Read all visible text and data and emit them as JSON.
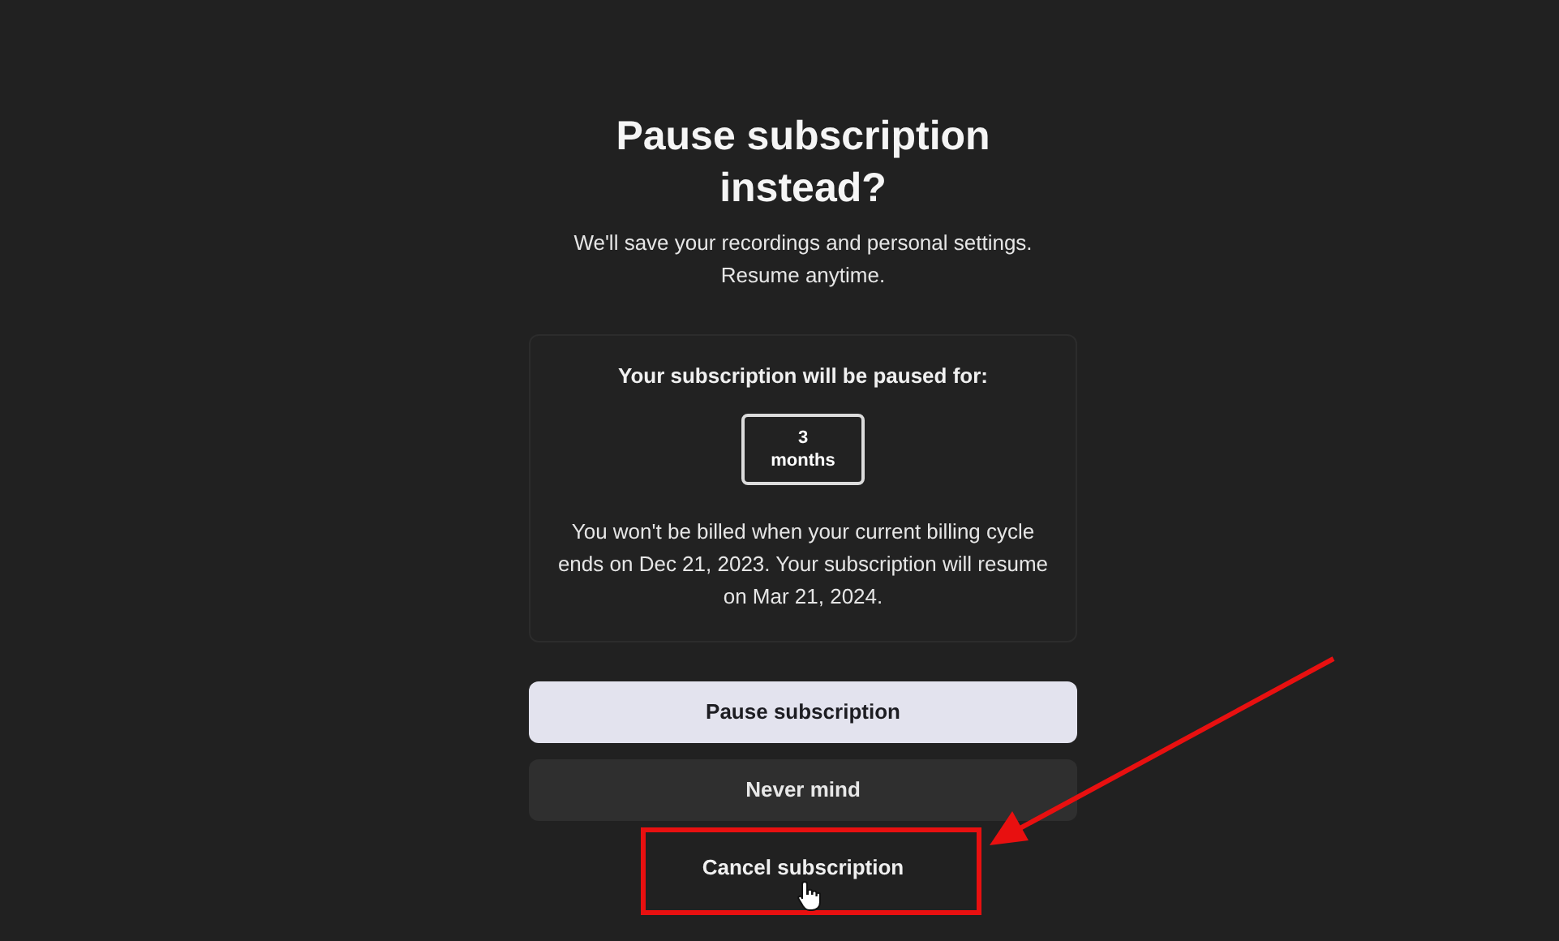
{
  "title": "Pause subscription instead?",
  "subtitle_lines": [
    "We'll save your recordings and personal settings.",
    "Resume anytime."
  ],
  "pause_card": {
    "heading": "Your subscription will be paused for:",
    "duration": {
      "number": "3",
      "unit": "months"
    },
    "note": "You won't be billed when your current billing cycle ends on Dec 21, 2023. Your subscription will resume on Mar 21, 2024."
  },
  "buttons": [
    {
      "kind": "primary",
      "label": "Pause subscription"
    },
    {
      "kind": "secondary",
      "label": "Never mind"
    },
    {
      "kind": "link",
      "label": "Cancel subscription"
    }
  ]
}
